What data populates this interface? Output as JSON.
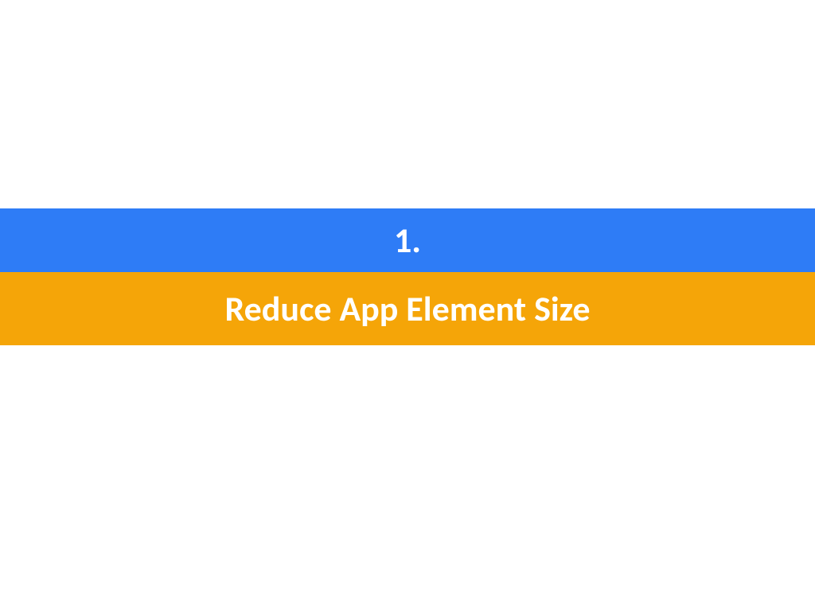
{
  "slide": {
    "number": "1.",
    "title": "Reduce App Element Size"
  },
  "colors": {
    "blue": "#2e7cf6",
    "orange": "#f5a508",
    "text": "#ffffff"
  }
}
